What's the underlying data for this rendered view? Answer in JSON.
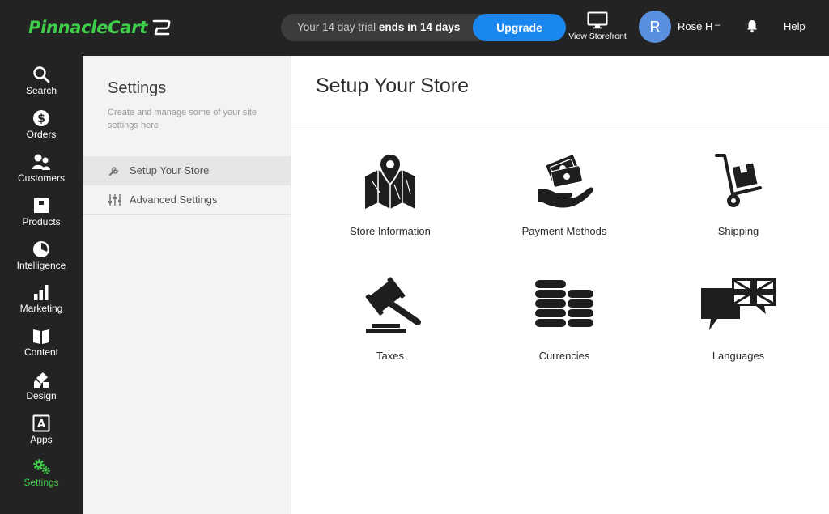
{
  "header": {
    "logo_text": "PinnacleCart",
    "trial_prefix": "Your 14 day trial ",
    "trial_emphasis": "ends in 14 days",
    "upgrade_label": "Upgrade",
    "storefront_label": "View Storefront",
    "avatar_initial": "R",
    "username": "Rose H",
    "help_label": "Help",
    "brand_color": "#3ecf4a",
    "upgrade_color": "#1a86f0"
  },
  "sidebar": {
    "items": [
      {
        "label": "Search",
        "icon": "search-icon"
      },
      {
        "label": "Orders",
        "icon": "dollar-icon"
      },
      {
        "label": "Customers",
        "icon": "users-icon"
      },
      {
        "label": "Products",
        "icon": "box-icon"
      },
      {
        "label": "Intelligence",
        "icon": "pie-chart-icon"
      },
      {
        "label": "Marketing",
        "icon": "bar-chart-icon"
      },
      {
        "label": "Content",
        "icon": "book-icon"
      },
      {
        "label": "Design",
        "icon": "paint-icon"
      },
      {
        "label": "Apps",
        "icon": "apps-icon"
      },
      {
        "label": "Settings",
        "icon": "gears-icon",
        "active": true
      }
    ]
  },
  "settings_panel": {
    "title": "Settings",
    "description": "Create and manage some of your site settings here",
    "menu": [
      {
        "label": "Setup Your Store",
        "icon": "wrench-icon",
        "active": true
      },
      {
        "label": "Advanced Settings",
        "icon": "sliders-icon"
      }
    ]
  },
  "main": {
    "title": "Setup Your Store",
    "tiles": [
      {
        "label": "Store Information",
        "icon": "map-pin-icon"
      },
      {
        "label": "Payment Methods",
        "icon": "hand-money-icon"
      },
      {
        "label": "Shipping",
        "icon": "hand-truck-icon"
      },
      {
        "label": "Taxes",
        "icon": "gavel-icon"
      },
      {
        "label": "Currencies",
        "icon": "coin-stacks-icon"
      },
      {
        "label": "Languages",
        "icon": "speech-flag-icon"
      }
    ]
  }
}
